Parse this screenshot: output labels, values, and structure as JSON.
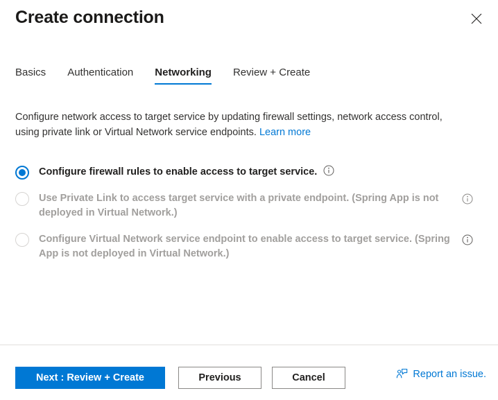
{
  "header": {
    "title": "Create connection",
    "close_label": "Close"
  },
  "tabs": [
    {
      "label": "Basics",
      "active": false
    },
    {
      "label": "Authentication",
      "active": false
    },
    {
      "label": "Networking",
      "active": true
    },
    {
      "label": "Review + Create",
      "active": false
    }
  ],
  "description": {
    "text": "Configure network access to target service by updating firewall settings, network access control, using private link or Virtual Network service endpoints.",
    "link_label": "Learn more"
  },
  "options": [
    {
      "label": "Configure firewall rules to enable access to target service.",
      "selected": true,
      "disabled": false,
      "info": "info-icon"
    },
    {
      "label": "Use Private Link to access target service with a private endpoint. (Spring App is not deployed in Virtual Network.)",
      "selected": false,
      "disabled": true,
      "info": "info-icon"
    },
    {
      "label": "Configure Virtual Network service endpoint to enable access to target service. (Spring App is not deployed in Virtual Network.)",
      "selected": false,
      "disabled": true,
      "info": "info-icon"
    }
  ],
  "footer": {
    "next_label": "Next : Review + Create",
    "previous_label": "Previous",
    "cancel_label": "Cancel",
    "report_issue_label": "Report an issue."
  },
  "colors": {
    "accent": "#0078d4",
    "text": "#323130",
    "disabled_text": "#a19f9d",
    "border": "#8a8886",
    "divider": "#e1dfdd"
  }
}
